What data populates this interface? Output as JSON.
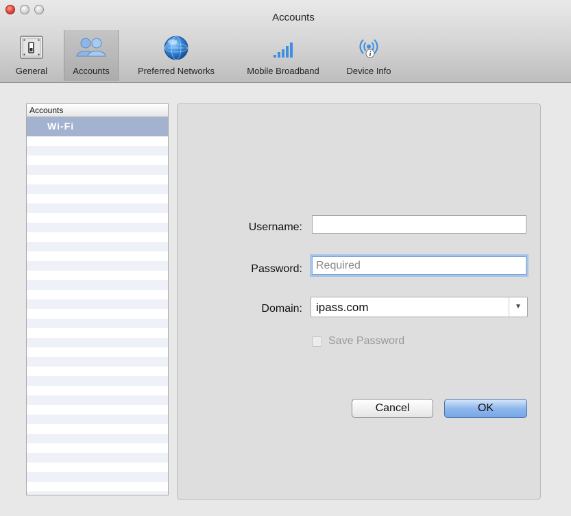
{
  "window": {
    "title": "Accounts"
  },
  "toolbar": {
    "items": [
      {
        "label": "General"
      },
      {
        "label": "Accounts"
      },
      {
        "label": "Preferred Networks"
      },
      {
        "label": "Mobile Broadband"
      },
      {
        "label": "Device Info"
      }
    ],
    "selected": "Accounts"
  },
  "accounts_list": {
    "header": "Accounts",
    "items": [
      "Wi-Fi"
    ],
    "selected": "Wi-Fi"
  },
  "form": {
    "username": {
      "label": "Username:",
      "value": "",
      "placeholder": ""
    },
    "password": {
      "label": "Password:",
      "value": "",
      "placeholder": "Required"
    },
    "domain": {
      "label": "Domain:",
      "value": "ipass.com"
    },
    "save_password": {
      "label": "Save Password",
      "checked": false,
      "enabled": false
    },
    "cancel_label": "Cancel",
    "ok_label": "OK"
  },
  "colors": {
    "selection": "#a3b3cf",
    "focus_ring": "#a9c4ea",
    "ok_button": "#8fb8ec",
    "close_button": "#e0443a"
  }
}
